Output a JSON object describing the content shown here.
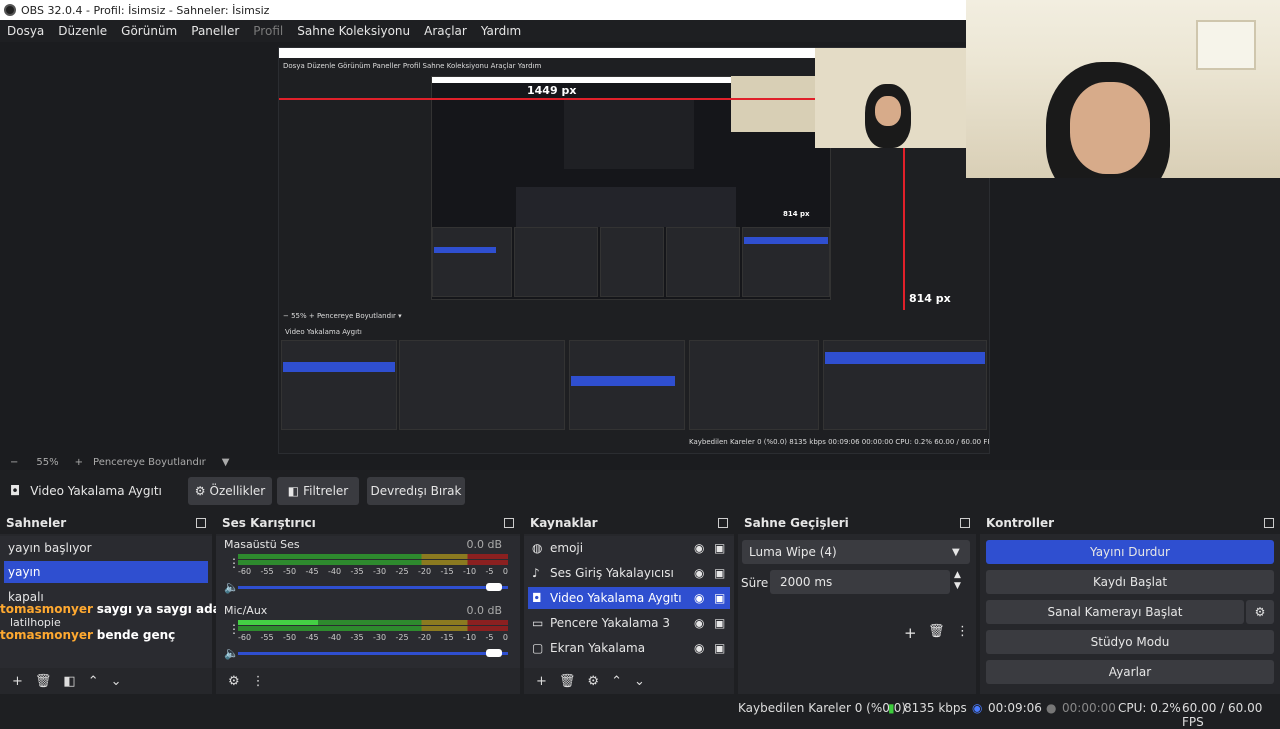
{
  "window": {
    "title": "OBS 32.0.4 - Profil: İsimsiz - Sahneler: İsimsiz"
  },
  "menu": [
    "Dosya",
    "Düzenle",
    "Görünüm",
    "Paneller",
    "Profil",
    "Sahne Koleksiyonu",
    "Araçlar",
    "Yardım"
  ],
  "preview": {
    "guide_top": "1449 px",
    "guide_right": "814 px",
    "guide_small": "814 px"
  },
  "zoom": {
    "minus": "−",
    "level": "55%",
    "plus": "+",
    "fit": "Pencereye Boyutlandır",
    "caret": "▼"
  },
  "source_bar": {
    "name": "Video Yakalama Aygıtı",
    "properties": "Özellikler",
    "filters": "Filtreler",
    "deactivate": "Devredışı Bırak"
  },
  "scenes": {
    "title": "Sahneler",
    "items": [
      "yayın başlıyor",
      "yayın",
      "kapalı"
    ],
    "chat": [
      {
        "user": "tomasmonyer",
        "msg": "saygı ya saygı adamim"
      },
      {
        "user": "tomasmonyer",
        "msg": "bende genç"
      }
    ],
    "chat_extra": "latilhopie"
  },
  "mixer": {
    "title": "Ses Karıştırıcı",
    "channels": [
      {
        "name": "Masaüstü Ses",
        "db": "0.0 dB"
      },
      {
        "name": "Mic/Aux",
        "db": "0.0 dB"
      }
    ],
    "ticks": [
      "-60",
      "-55",
      "-50",
      "-45",
      "-40",
      "-35",
      "-30",
      "-25",
      "-20",
      "-15",
      "-10",
      "-5",
      "0"
    ]
  },
  "sources": {
    "title": "Kaynaklar",
    "items": [
      {
        "name": "emoji",
        "icon": "globe-icon"
      },
      {
        "name": "Ses Giriş Yakalayıcısı",
        "icon": "mic-icon"
      },
      {
        "name": "Video Yakalama Aygıtı",
        "icon": "camera-icon"
      },
      {
        "name": "Pencere Yakalama 3",
        "icon": "window-icon"
      },
      {
        "name": "Ekran Yakalama",
        "icon": "monitor-icon"
      }
    ]
  },
  "transitions": {
    "title": "Sahne Geçişleri",
    "selected": "Luma Wipe (4)",
    "duration_label": "Süre",
    "duration": "2000 ms"
  },
  "controls": {
    "title": "Kontroller",
    "stop_stream": "Yayını Durdur",
    "start_record": "Kaydı Başlat",
    "virtual_cam": "Sanal Kamerayı Başlat",
    "studio": "Stüdyo Modu",
    "settings": "Ayarlar"
  },
  "status": {
    "dropped": "Kaybedilen Kareler 0 (%0.0)",
    "bitrate": "8135 kbps",
    "stream_time": "00:09:06",
    "rec_time": "00:00:00",
    "cpu": "CPU: 0.2%",
    "fps": "60.00 / 60.00 FPS"
  },
  "colors": {
    "accent": "#2f4fd0",
    "chat_user": "#ffa930"
  }
}
